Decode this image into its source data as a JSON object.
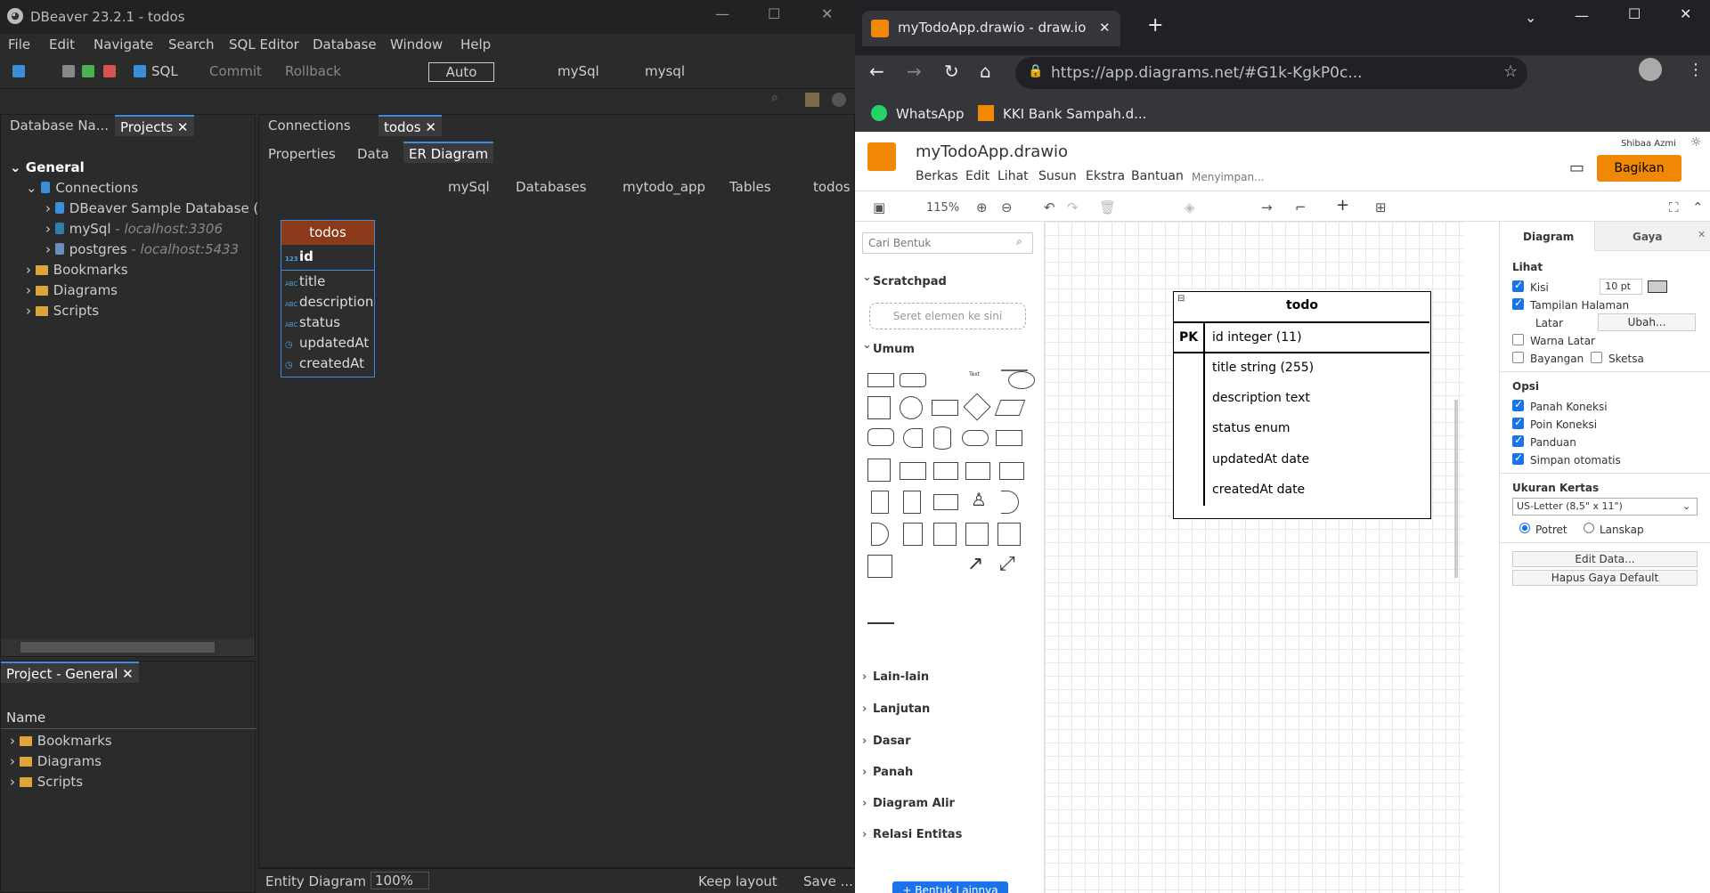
{
  "dbeaver": {
    "window_title": "DBeaver 23.2.1 - todos",
    "menu": [
      "File",
      "Edit",
      "Navigate",
      "Search",
      "SQL Editor",
      "Database",
      "Window",
      "Help"
    ],
    "toolbar": {
      "sql": "SQL",
      "commit": "Commit",
      "rollback": "Rollback",
      "mode": "Auto",
      "conn1": "mySql",
      "conn2": "mysql"
    },
    "left_tabs": {
      "tab1": "Database Na...",
      "tab2": "Projects"
    },
    "tree": {
      "general": "General",
      "connections": "Connections",
      "sample_db": "DBeaver Sample Database (SQ",
      "mysql": "mySql",
      "mysql_host": "- localhost:3306",
      "postgres": "postgres",
      "postgres_host": "- localhost:5433",
      "bookmarks": "Bookmarks",
      "diagrams": "Diagrams",
      "scripts": "Scripts"
    },
    "project_panel": {
      "tab": "Project - General",
      "column": "Name",
      "items": [
        "Bookmarks",
        "Diagrams",
        "Scripts"
      ]
    },
    "editor_tabs": {
      "connections": "Connections",
      "todos": "todos"
    },
    "sub_tabs": {
      "properties": "Properties",
      "data": "Data",
      "er": "ER Diagram"
    },
    "breadcrumb": {
      "conn": "mySql",
      "databases": "Databases",
      "db": "mytodo_app",
      "tables": "Tables",
      "table": "todos"
    },
    "er_table": {
      "name": "todos",
      "columns": [
        "id",
        "title",
        "description",
        "status",
        "updatedAt",
        "createdAt"
      ]
    },
    "status": {
      "label": "Entity Diagram",
      "zoom": "100%",
      "keep": "Keep layout",
      "save": "Save ..."
    }
  },
  "chrome": {
    "tab_title": "myTodoApp.drawio - draw.io",
    "url": "https://app.diagrams.net/#G1k-KgkP0c...",
    "bookmarks": [
      "WhatsApp",
      "KKI Bank Sampah.d..."
    ]
  },
  "drawio": {
    "file_name": "myTodoApp.drawio",
    "menu": [
      "Berkas",
      "Edit",
      "Lihat",
      "Susun",
      "Ekstra",
      "Bantuan"
    ],
    "saving": "Menyimpan...",
    "user": "Shibaa Azmi",
    "share": "Bagikan",
    "zoom": "115%",
    "search_placeholder": "Cari Bentuk",
    "scratchpad": "Scratchpad",
    "drop_hint": "Seret elemen ke sini",
    "general": "Umum",
    "sections": [
      "Lain-lain",
      "Lanjutan",
      "Dasar",
      "Panah",
      "Diagram Alir",
      "Relasi Entitas"
    ],
    "more_shapes": "+ Bentuk Lainnya",
    "entity": {
      "title": "todo",
      "pk": "PK",
      "pk_field": "id integer (11)",
      "fields": [
        "title string (255)",
        "description text",
        "status enum",
        "updatedAt  date",
        "createdAt date"
      ]
    },
    "format": {
      "tab_diagram": "Diagram",
      "tab_style": "Gaya",
      "view": "Lihat",
      "grid": "Kisi",
      "grid_size": "10 pt",
      "page_view": "Tampilan Halaman",
      "background": "Latar",
      "change": "Ubah...",
      "bg_color": "Warna Latar",
      "shadow": "Bayangan",
      "sketch": "Sketsa",
      "options": "Opsi",
      "connection_arrows": "Panah Koneksi",
      "connection_points": "Poin Koneksi",
      "guides": "Panduan",
      "autosave": "Simpan otomatis",
      "paper_size": "Ukuran Kertas",
      "paper": "US-Letter (8,5\" x 11\")",
      "portrait": "Potret",
      "landscape": "Lanskap",
      "edit_data": "Edit Data...",
      "clear_style": "Hapus Gaya Default"
    }
  }
}
